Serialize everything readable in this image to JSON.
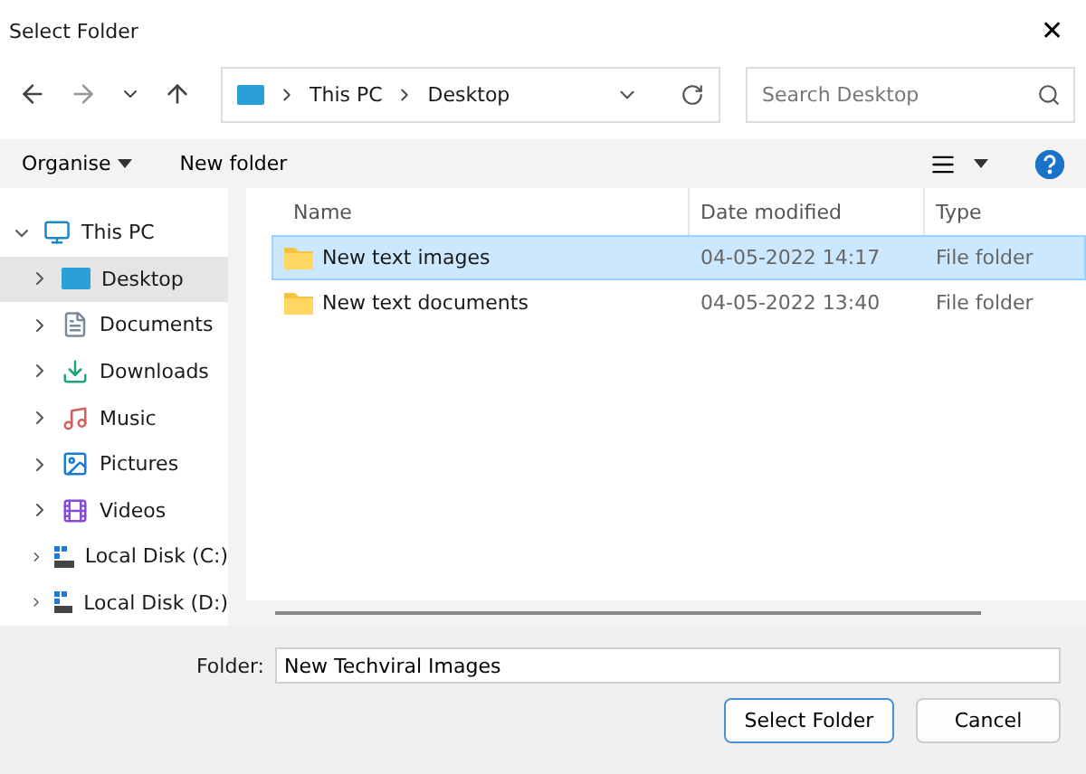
{
  "window": {
    "title": "Select Folder",
    "close": "✕"
  },
  "address": {
    "path": [
      "This PC",
      "Desktop"
    ],
    "search_placeholder": "Search Desktop"
  },
  "toolbar": {
    "organise": "Organise",
    "new_folder": "New folder"
  },
  "sidebar": {
    "items": [
      {
        "label": "This PC",
        "kind": "pc",
        "expanded": true,
        "selected": false,
        "children": [
          {
            "label": "Desktop",
            "kind": "desktop",
            "expanded": false,
            "selected": true
          },
          {
            "label": "Documents",
            "kind": "documents",
            "expanded": false,
            "selected": false
          },
          {
            "label": "Downloads",
            "kind": "downloads",
            "expanded": false,
            "selected": false
          },
          {
            "label": "Music",
            "kind": "music",
            "expanded": false,
            "selected": false
          },
          {
            "label": "Pictures",
            "kind": "pictures",
            "expanded": false,
            "selected": false
          },
          {
            "label": "Videos",
            "kind": "videos",
            "expanded": false,
            "selected": false
          },
          {
            "label": "Local Disk (C:)",
            "kind": "disk",
            "expanded": false,
            "selected": false
          },
          {
            "label": "Local Disk (D:)",
            "kind": "disk",
            "expanded": false,
            "selected": false
          }
        ]
      }
    ]
  },
  "table": {
    "columns": [
      "Name",
      "Date modified",
      "Type"
    ],
    "rows": [
      {
        "name": "New text images",
        "date": "04-05-2022 14:17",
        "type": "File folder",
        "selected": true
      },
      {
        "name": "New text documents",
        "date": "04-05-2022 13:40",
        "type": "File folder",
        "selected": false
      }
    ]
  },
  "footer": {
    "label": "Folder:",
    "value": "New Techviral Images",
    "buttons": [
      {
        "label": "Select Folder",
        "primary": true
      },
      {
        "label": "Cancel",
        "primary": false
      }
    ]
  }
}
